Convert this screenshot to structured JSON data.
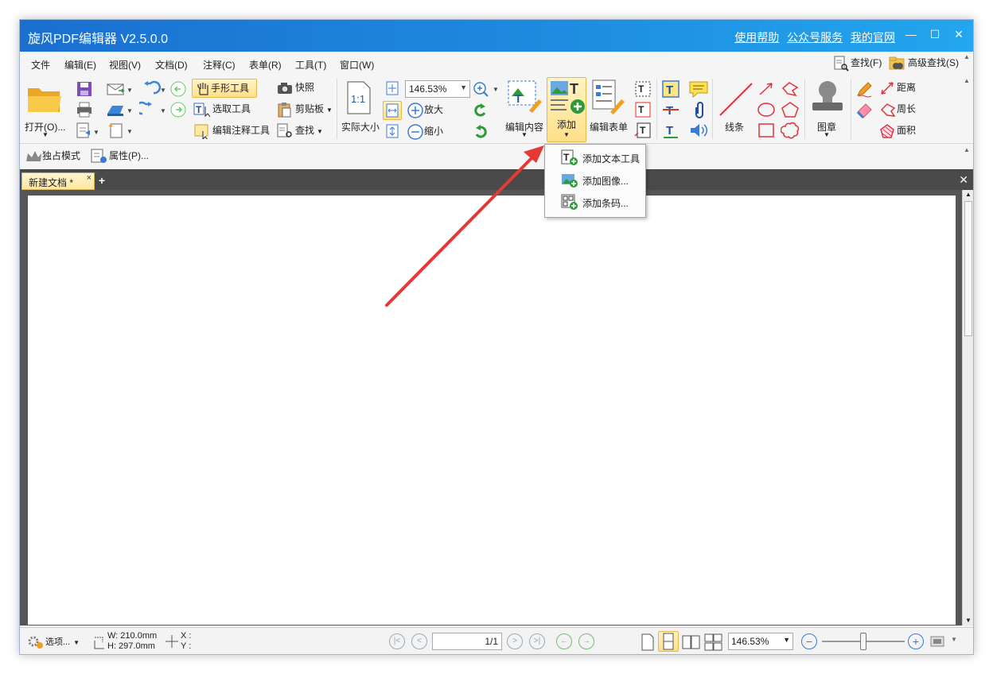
{
  "window": {
    "title": "旋风PDF编辑器 V2.5.0.0",
    "links": [
      "使用帮助",
      "公众号服务",
      "我的官网"
    ]
  },
  "menu": [
    "文件",
    "编辑(E)",
    "视图(V)",
    "文档(D)",
    "注释(C)",
    "表单(R)",
    "工具(T)",
    "窗口(W)"
  ],
  "search": {
    "find": "查找(F)",
    "advanced_find": "高级查找(S)"
  },
  "ribbon": {
    "open": "打开(O)...",
    "hand_tool": "手形工具",
    "select_tool": "选取工具",
    "edit_annot_tool": "编辑注释工具",
    "snapshot": "快照",
    "clipboard": "剪贴板",
    "find": "查找",
    "actual_size": "实际大小",
    "actual_size_icon": "1:1",
    "zoom_value": "146.53%",
    "zoom_in": "放大",
    "zoom_out": "缩小",
    "edit_content": "编辑内容",
    "add": "添加",
    "edit_form": "编辑表单",
    "lines": "线条",
    "stamp": "图章",
    "distance": "距离",
    "perimeter": "周长",
    "area": "面积"
  },
  "toolbar2": {
    "exclusive_mode": "独占模式",
    "properties": "属性(P)..."
  },
  "tab": {
    "label": "新建文档 *",
    "close": "×",
    "new": "+"
  },
  "add_menu": [
    "添加文本工具",
    "添加图像...",
    "添加条码..."
  ],
  "status": {
    "options": "选项...",
    "width": "W: 210.0mm",
    "height": "H: 297.0mm",
    "x": "X :",
    "y": "Y :",
    "page": "1/1",
    "zoom": "146.53%",
    "zoom_slider_fraction": 0.5
  },
  "colors": {
    "titlebar": "#1e88e5",
    "annotation_arrow": "#e53935",
    "active_tool": "#ffe08a"
  }
}
